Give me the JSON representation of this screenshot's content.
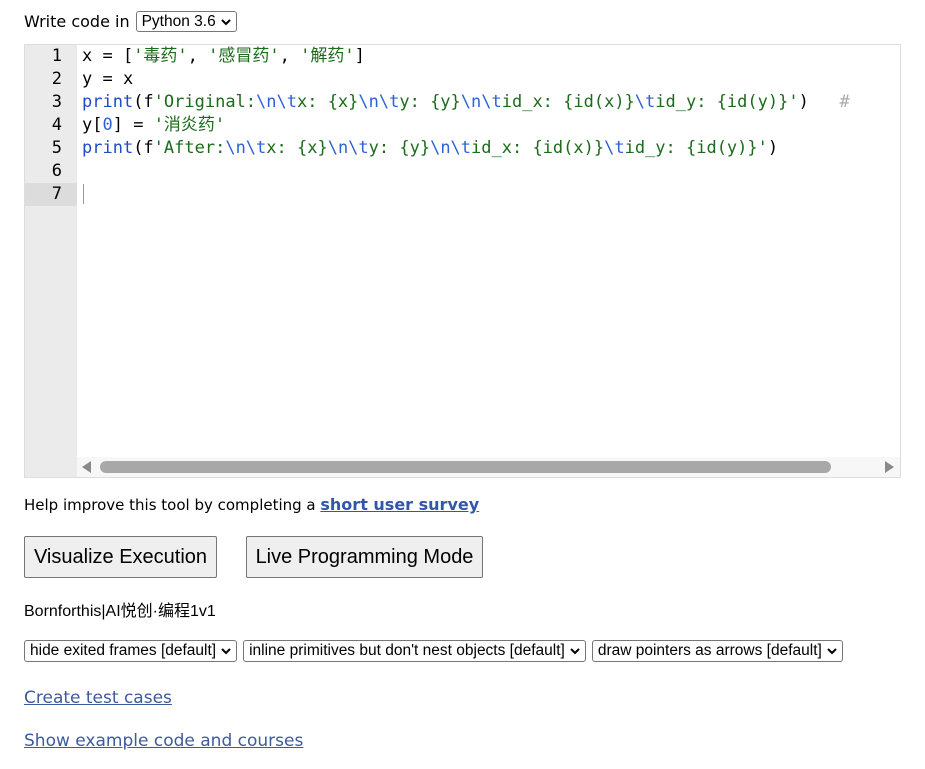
{
  "language": {
    "label": "Write code in",
    "selected": "Python 3.6"
  },
  "editor": {
    "line_numbers": [
      "1",
      "2",
      "3",
      "4",
      "5",
      "6",
      "7"
    ],
    "active_line": 7,
    "lines": [
      [
        {
          "t": "x = [",
          "c": ""
        },
        {
          "t": "'毒药'",
          "c": "str"
        },
        {
          "t": ", ",
          "c": ""
        },
        {
          "t": "'感冒药'",
          "c": "str"
        },
        {
          "t": ", ",
          "c": ""
        },
        {
          "t": "'解药'",
          "c": "str"
        },
        {
          "t": "]",
          "c": ""
        }
      ],
      [
        {
          "t": "y = x",
          "c": ""
        }
      ],
      [
        {
          "t": "print",
          "c": "kw"
        },
        {
          "t": "(f",
          "c": ""
        },
        {
          "t": "'Original:",
          "c": "str"
        },
        {
          "t": "\\n\\t",
          "c": "esc"
        },
        {
          "t": "x: {x}",
          "c": "str"
        },
        {
          "t": "\\n\\t",
          "c": "esc"
        },
        {
          "t": "y: {y}",
          "c": "str"
        },
        {
          "t": "\\n\\t",
          "c": "esc"
        },
        {
          "t": "id_x: {id(x)}",
          "c": "str"
        },
        {
          "t": "\\t",
          "c": "esc"
        },
        {
          "t": "id_y: {id(y)}'",
          "c": "str"
        },
        {
          "t": ")   ",
          "c": ""
        },
        {
          "t": "#",
          "c": "cmt"
        }
      ],
      [
        {
          "t": "y[",
          "c": ""
        },
        {
          "t": "0",
          "c": "esc"
        },
        {
          "t": "] = ",
          "c": ""
        },
        {
          "t": "'消炎药'",
          "c": "str"
        }
      ],
      [
        {
          "t": "print",
          "c": "kw"
        },
        {
          "t": "(f",
          "c": ""
        },
        {
          "t": "'After:",
          "c": "str"
        },
        {
          "t": "\\n\\t",
          "c": "esc"
        },
        {
          "t": "x: {x}",
          "c": "str"
        },
        {
          "t": "\\n\\t",
          "c": "esc"
        },
        {
          "t": "y: {y}",
          "c": "str"
        },
        {
          "t": "\\n\\t",
          "c": "esc"
        },
        {
          "t": "id_x: {id(x)}",
          "c": "str"
        },
        {
          "t": "\\t",
          "c": "esc"
        },
        {
          "t": "id_y: {id(y)}'",
          "c": "str"
        },
        {
          "t": ")",
          "c": ""
        }
      ],
      [],
      []
    ]
  },
  "survey": {
    "prefix": "Help improve this tool by completing a ",
    "link": "short user survey"
  },
  "buttons": {
    "visualize": "Visualize Execution",
    "live": "Live Programming Mode"
  },
  "author": "Bornforthis|AI悦创·编程1v1",
  "options": {
    "frames": "hide exited frames [default]",
    "primitives": "inline primitives but don't nest objects [default]",
    "pointers": "draw pointers as arrows [default]"
  },
  "links": {
    "tests": "Create test cases",
    "examples": "Show example code and courses"
  }
}
